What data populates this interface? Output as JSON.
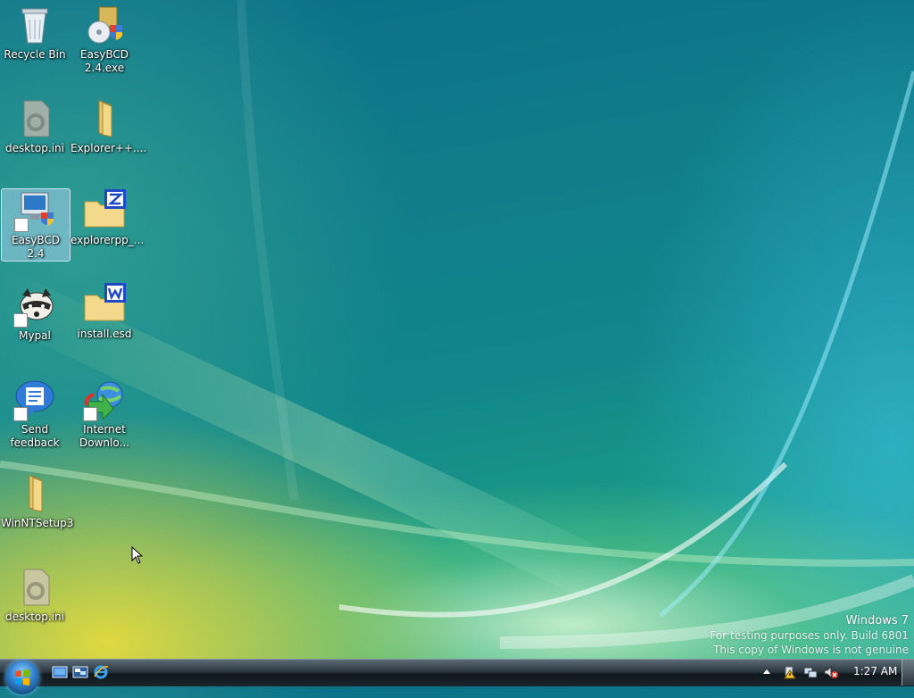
{
  "desktop_icons": [
    {
      "label": "Recycle Bin",
      "icon": "recycle-bin-icon"
    },
    {
      "label": "EasyBCD 2.4.exe",
      "icon": "installer-icon"
    },
    {
      "label": "desktop.ini",
      "icon": "settings-file-icon"
    },
    {
      "label": "Explorer++....",
      "icon": "folder-icon"
    },
    {
      "label": "EasyBCD 2.4",
      "icon": "easybcd-icon",
      "selected": true
    },
    {
      "label": "explorerpp_...",
      "icon": "zip-folder-icon"
    },
    {
      "label": "Mypal",
      "icon": "raccoon-icon"
    },
    {
      "label": "install.esd",
      "icon": "wim-folder-icon"
    },
    {
      "label": "Send feedback",
      "icon": "feedback-icon"
    },
    {
      "label": "Internet Downlo...",
      "icon": "download-manager-icon"
    },
    {
      "label": "WinNTSetup3",
      "icon": "folder-icon"
    },
    {
      "label": "desktop.ini",
      "icon": "settings-file-icon"
    }
  ],
  "watermark": {
    "line1": "Windows 7",
    "line2": "For testing purposes only. Build 6801",
    "line3": "This copy of Windows is not genuine"
  },
  "taskbar": {
    "clock": "1:27 AM",
    "quick_launch": [
      "show-desktop-icon",
      "switch-windows-icon",
      "internet-explorer-icon"
    ],
    "tray_icons": [
      "show-hidden-icons-arrow",
      "action-center-warning-icon",
      "network-icon",
      "volume-muted-icon"
    ]
  }
}
